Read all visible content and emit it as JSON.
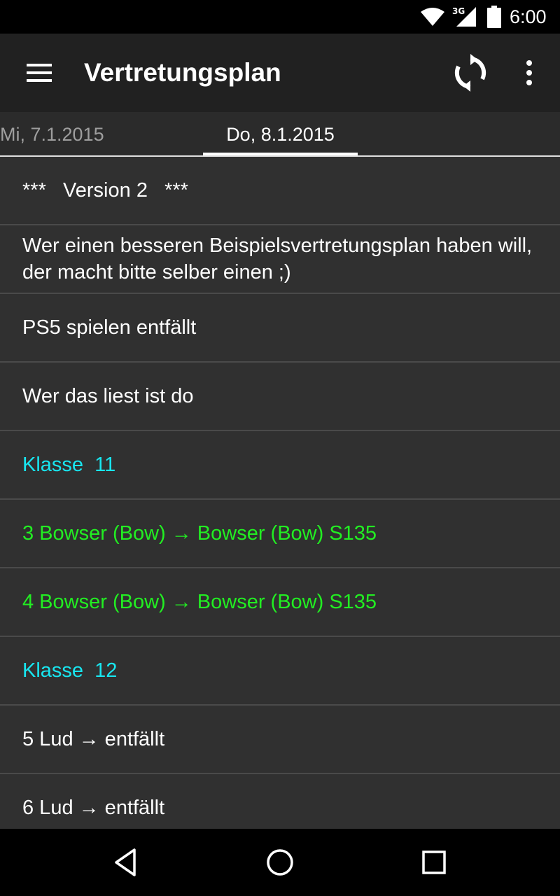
{
  "status_bar": {
    "network": "3G",
    "time": "6:00",
    "icons": [
      "wifi-icon",
      "cell-signal-icon",
      "battery-icon"
    ]
  },
  "app_bar": {
    "title": "Vertretungsplan",
    "icons": [
      "menu-icon",
      "refresh-icon",
      "overflow-menu-icon"
    ]
  },
  "tabs": [
    {
      "label": "Mi, 7.1.2015",
      "selected": false
    },
    {
      "label": "Do, 8.1.2015",
      "selected": true
    }
  ],
  "list": [
    {
      "text": "***   Version 2   ***",
      "kind": "info"
    },
    {
      "text": "Wer einen besseren Beispielsvertretungsplan haben will, der macht bitte selber einen ;)",
      "kind": "info"
    },
    {
      "text": "PS5 spielen entfällt",
      "kind": "info"
    },
    {
      "text": "Wer das liest ist do",
      "kind": "info"
    },
    {
      "text": "Klasse  11",
      "kind": "class-header"
    },
    {
      "text": "3 Bowser (Bow) → Bowser (Bow) S135",
      "kind": "substitution"
    },
    {
      "text": "4 Bowser (Bow) → Bowser (Bow) S135",
      "kind": "substitution"
    },
    {
      "text": "Klasse  12",
      "kind": "class-header"
    },
    {
      "text": "5 Lud → entfällt",
      "kind": "cancellation"
    },
    {
      "text": "6 Lud → entfällt",
      "kind": "cancellation"
    }
  ],
  "nav_bar": {
    "icons": [
      "back-icon",
      "home-icon",
      "recents-icon"
    ]
  },
  "colors": {
    "class_header": "#18e6f0",
    "substitution": "#22ee22",
    "text": "#ffffff",
    "background": "#303030",
    "app_bar": "#212121"
  }
}
